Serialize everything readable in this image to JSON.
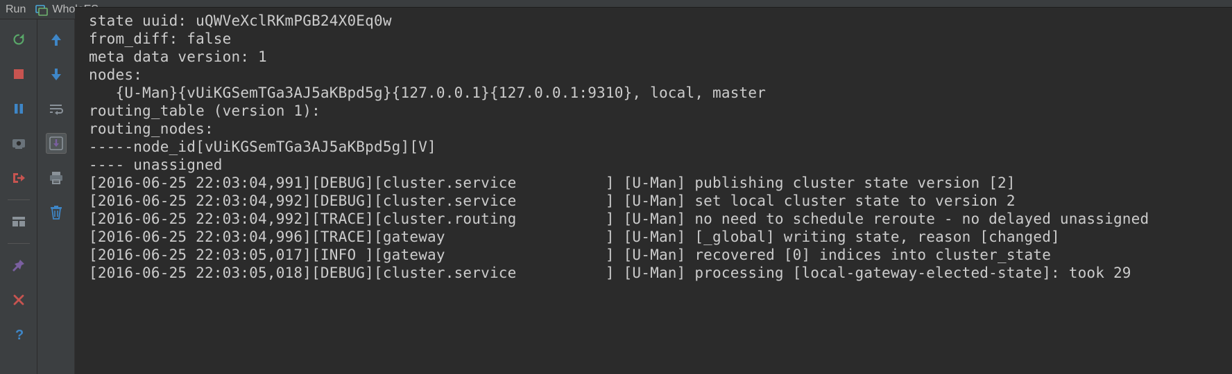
{
  "header": {
    "run_label": "Run",
    "config_name": "WholeES"
  },
  "gutter_left": [
    {
      "name": "rerun-icon"
    },
    {
      "name": "stop-icon"
    },
    {
      "name": "pause-icon"
    },
    {
      "name": "dump-threads-icon"
    },
    {
      "name": "exit-icon"
    },
    {
      "sep": true
    },
    {
      "name": "layout-icon"
    },
    {
      "sep": true
    },
    {
      "name": "pin-icon"
    },
    {
      "name": "close-icon"
    },
    {
      "name": "help-icon"
    }
  ],
  "gutter_right": [
    {
      "name": "up-icon"
    },
    {
      "name": "down-icon"
    },
    {
      "name": "soft-wrap-icon"
    },
    {
      "name": "scroll-to-end-icon",
      "active": true
    },
    {
      "name": "print-icon"
    },
    {
      "name": "clear-all-icon"
    }
  ],
  "console": {
    "lines": [
      "state uuid: uQWVeXclRKmPGB24X0Eq0w",
      "from_diff: false",
      "meta data version: 1",
      "nodes:",
      "   {U-Man}{vUiKGSemTGa3AJ5aKBpd5g}{127.0.0.1}{127.0.0.1:9310}, local, master",
      "routing_table (version 1):",
      "routing_nodes:",
      "-----node_id[vUiKGSemTGa3AJ5aKBpd5g][V]",
      "---- unassigned",
      "",
      "[2016-06-25 22:03:04,991][DEBUG][cluster.service          ] [U-Man] publishing cluster state version [2]",
      "[2016-06-25 22:03:04,992][DEBUG][cluster.service          ] [U-Man] set local cluster state to version 2",
      "[2016-06-25 22:03:04,992][TRACE][cluster.routing          ] [U-Man] no need to schedule reroute - no delayed unassigned",
      "[2016-06-25 22:03:04,996][TRACE][gateway                  ] [U-Man] [_global] writing state, reason [changed]",
      "[2016-06-25 22:03:05,017][INFO ][gateway                  ] [U-Man] recovered [0] indices into cluster_state",
      "[2016-06-25 22:03:05,018][DEBUG][cluster.service          ] [U-Man] processing [local-gateway-elected-state]: took 29"
    ]
  }
}
